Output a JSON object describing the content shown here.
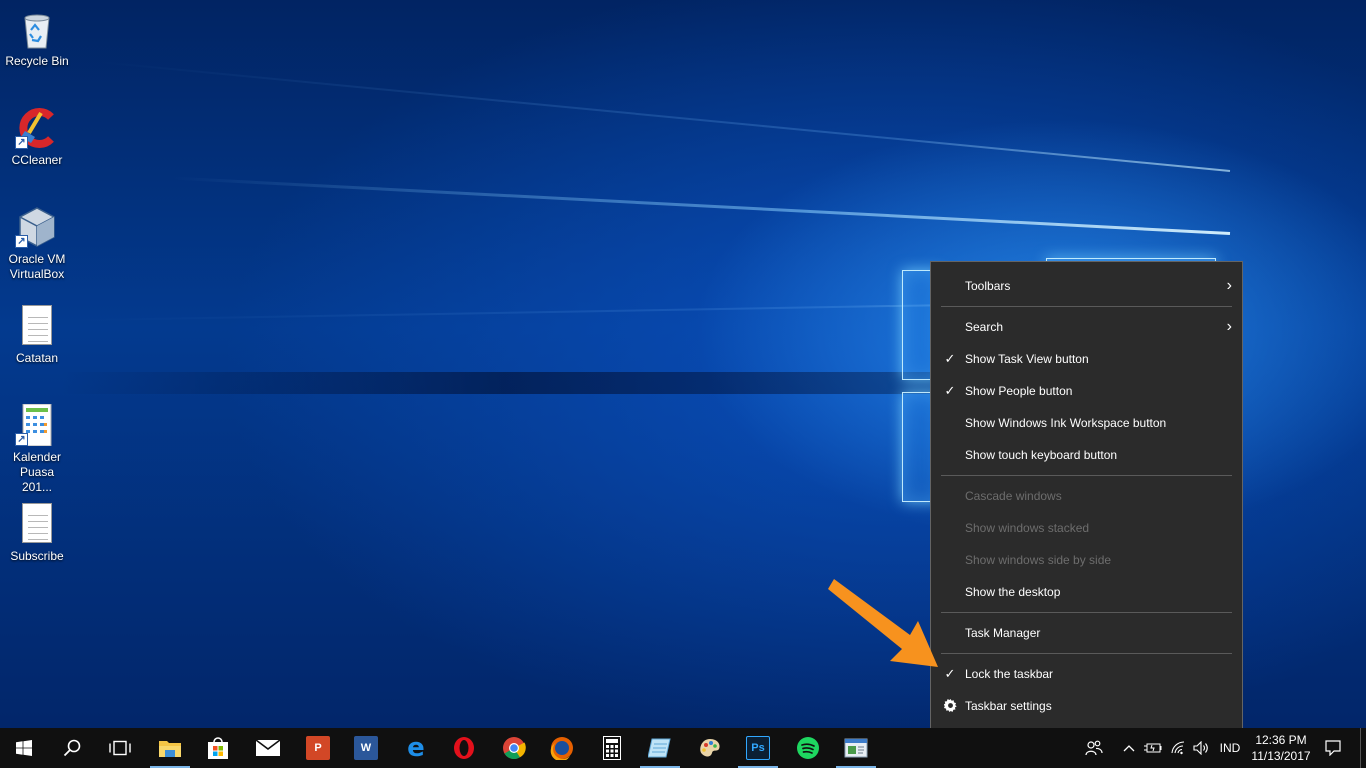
{
  "desktop": {
    "icons": [
      {
        "label": "Recycle Bin",
        "icon": "recycle-bin-icon"
      },
      {
        "label": "CCleaner",
        "icon": "ccleaner-icon"
      },
      {
        "label": "Oracle VM VirtualBox",
        "icon": "virtualbox-icon"
      },
      {
        "label": "Catatan",
        "icon": "text-document-icon"
      },
      {
        "label": "Kalender Puasa 201...",
        "icon": "calendar-image-icon"
      },
      {
        "label": "Subscribe",
        "icon": "text-document-icon"
      }
    ]
  },
  "context_menu": {
    "items": [
      {
        "label": "Toolbars",
        "has_submenu": true,
        "checked": false,
        "disabled": false
      },
      {
        "label": "Search",
        "has_submenu": true,
        "checked": false,
        "disabled": false
      },
      {
        "label": "Show Task View button",
        "checked": true,
        "disabled": false
      },
      {
        "label": "Show People button",
        "checked": true,
        "disabled": false
      },
      {
        "label": "Show Windows Ink Workspace button",
        "checked": false,
        "disabled": false
      },
      {
        "label": "Show touch keyboard button",
        "checked": false,
        "disabled": false
      },
      {
        "label": "Cascade windows",
        "checked": false,
        "disabled": true
      },
      {
        "label": "Show windows stacked",
        "checked": false,
        "disabled": true
      },
      {
        "label": "Show windows side by side",
        "checked": false,
        "disabled": true
      },
      {
        "label": "Show the desktop",
        "checked": false,
        "disabled": false
      },
      {
        "label": "Task Manager",
        "checked": false,
        "disabled": false
      },
      {
        "label": "Lock the taskbar",
        "checked": true,
        "disabled": false
      },
      {
        "label": "Taskbar settings",
        "icon": "gear-icon",
        "disabled": false
      }
    ]
  },
  "taskbar": {
    "pinned": [
      {
        "name": "file-explorer",
        "icon": "folder-icon",
        "running": true
      },
      {
        "name": "store",
        "icon": "store-bag-icon",
        "running": false
      },
      {
        "name": "mail",
        "icon": "mail-icon",
        "running": false
      },
      {
        "name": "powerpoint",
        "icon": "powerpoint-icon",
        "letter": "P",
        "running": false
      },
      {
        "name": "word",
        "icon": "word-icon",
        "letter": "W",
        "running": false
      },
      {
        "name": "edge",
        "icon": "edge-icon",
        "letter": "e",
        "running": false
      },
      {
        "name": "opera",
        "icon": "opera-icon",
        "letter": "O",
        "running": false
      },
      {
        "name": "chrome",
        "icon": "chrome-icon",
        "running": false
      },
      {
        "name": "firefox",
        "icon": "firefox-icon",
        "running": false
      },
      {
        "name": "calculator",
        "icon": "calculator-icon",
        "running": false
      },
      {
        "name": "notepad",
        "icon": "notepad-icon",
        "running": true
      },
      {
        "name": "paint",
        "icon": "paint-palette-icon",
        "running": false
      },
      {
        "name": "photoshop",
        "icon": "photoshop-icon",
        "letter": "Ps",
        "running": true
      },
      {
        "name": "spotify",
        "icon": "spotify-icon",
        "running": false
      },
      {
        "name": "app-window",
        "icon": "app-window-icon",
        "running": true
      }
    ],
    "language": "IND",
    "clock": {
      "time": "12:36 PM",
      "date": "11/13/2017"
    }
  },
  "colors": {
    "menu_bg": "#2b2b2b",
    "taskbar_bg": "#101010",
    "annotation": "#f7921e",
    "running_indicator": "#7bb5e8"
  }
}
